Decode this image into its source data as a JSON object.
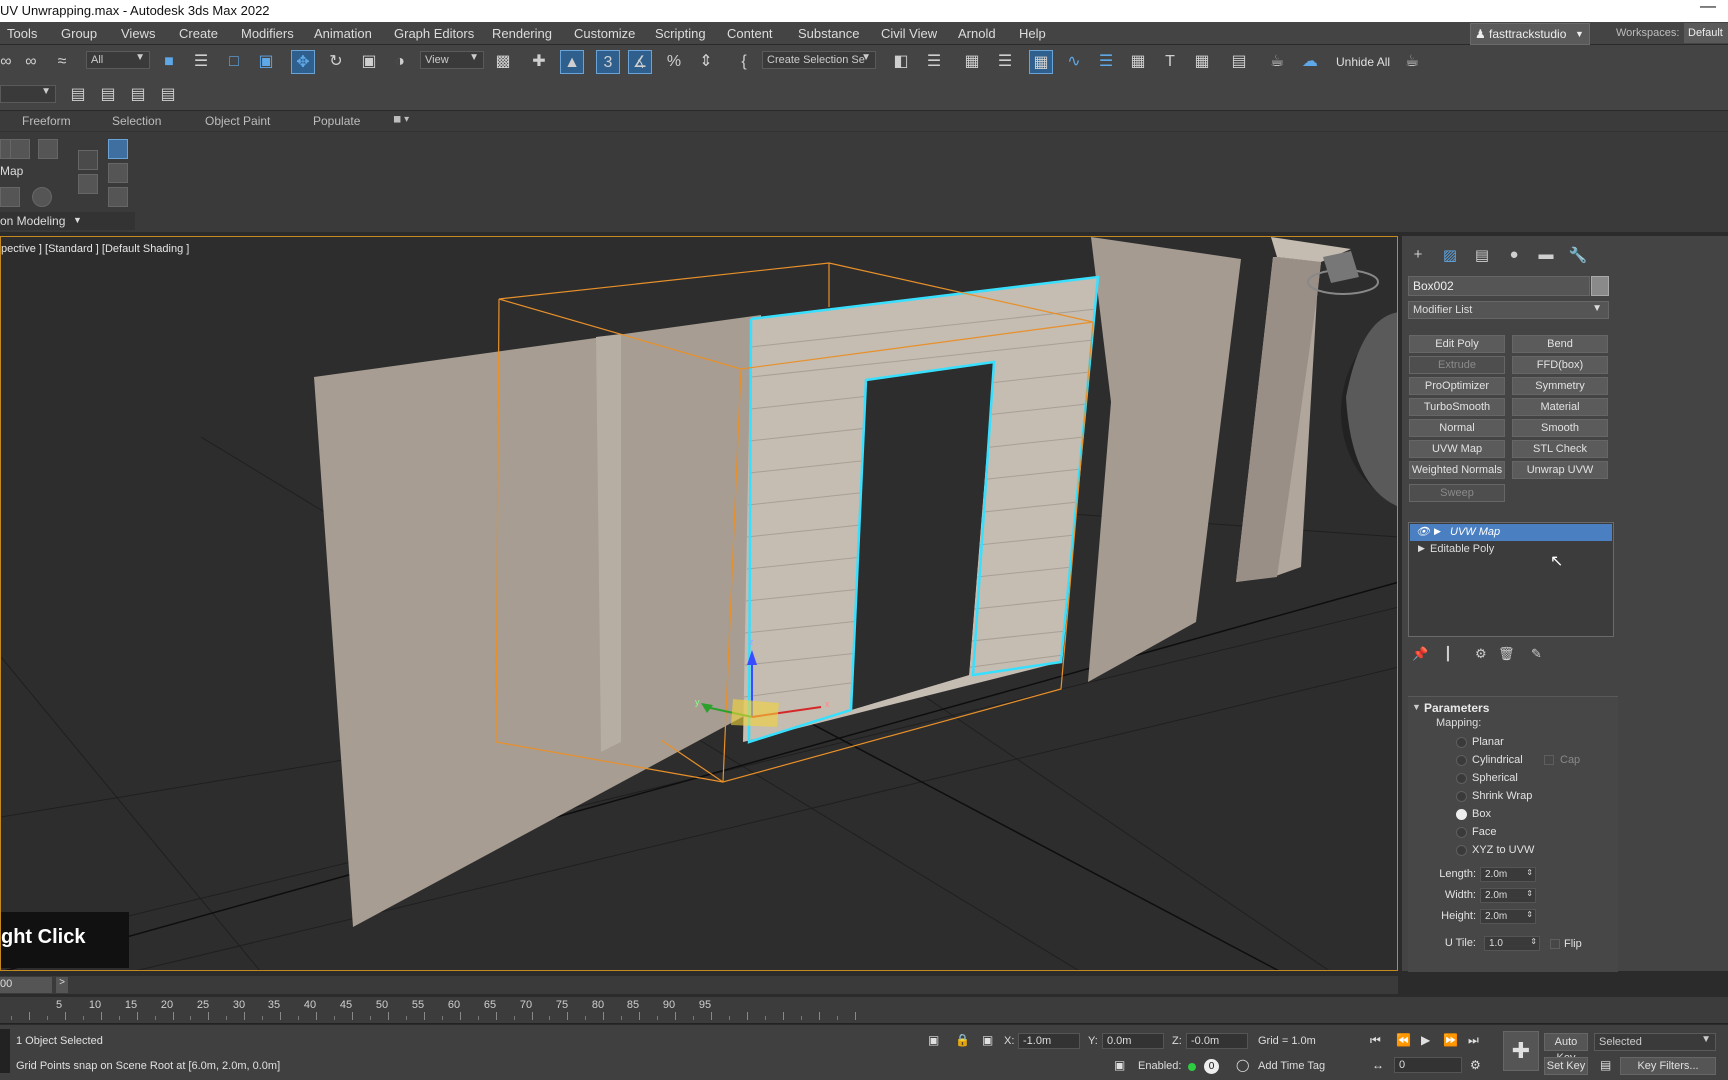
{
  "window": {
    "title": "UV Unwrapping.max - Autodesk 3ds Max 2022",
    "minimize": "—"
  },
  "menu": {
    "items": [
      "Tools",
      "Group",
      "Views",
      "Create",
      "Modifiers",
      "Animation",
      "Graph Editors",
      "Rendering",
      "Customize",
      "Scripting",
      "Content",
      "Substance",
      "Civil View",
      "Arnold",
      "Help"
    ],
    "user": "fasttrackstudio",
    "workspaces_label": "Workspaces:",
    "workspace_value": "Default"
  },
  "toolbar": {
    "filter_value": "All",
    "refcoord_value": "View",
    "named_selection_value": "Create Selection Se",
    "unhide_label": "Unhide All"
  },
  "ribbon": {
    "tabs": [
      "Freeform",
      "Selection",
      "Object Paint",
      "Populate"
    ],
    "map_label": "Map",
    "poly_modeling_label": "on Modeling"
  },
  "viewport": {
    "label": "pective ] [Standard ] [Default Shading ]",
    "hint": "ght Click"
  },
  "command_panel": {
    "object_name": "Box002",
    "object_color": "#8a8a8a",
    "modifier_list": "Modifier List",
    "modifier_buttons": [
      {
        "label": "Edit Poly",
        "enabled": true
      },
      {
        "label": "Bend",
        "enabled": true
      },
      {
        "label": "Extrude",
        "enabled": false
      },
      {
        "label": "FFD(box)",
        "enabled": true
      },
      {
        "label": "ProOptimizer",
        "enabled": true
      },
      {
        "label": "Symmetry",
        "enabled": true
      },
      {
        "label": "TurboSmooth",
        "enabled": true
      },
      {
        "label": "Material",
        "enabled": true
      },
      {
        "label": "Normal",
        "enabled": true
      },
      {
        "label": "Smooth",
        "enabled": true
      },
      {
        "label": "UVW Map",
        "enabled": true
      },
      {
        "label": "STL Check",
        "enabled": true
      },
      {
        "label": "Weighted Normals",
        "enabled": true
      },
      {
        "label": "Unwrap UVW",
        "enabled": true
      },
      {
        "label": "Sweep",
        "enabled": false
      }
    ],
    "stack": [
      {
        "label": "UVW Map",
        "selected": true
      },
      {
        "label": "Editable Poly",
        "selected": false
      }
    ],
    "parameters": {
      "title": "Parameters",
      "mapping_label": "Mapping:",
      "mapping_options": [
        "Planar",
        "Cylindrical",
        "Spherical",
        "Shrink Wrap",
        "Box",
        "Face",
        "XYZ to UVW"
      ],
      "mapping_selected": "Box",
      "cap_label": "Cap",
      "length_label": "Length:",
      "length": "2.0m",
      "width_label": "Width:",
      "width": "2.0m",
      "height_label": "Height:",
      "height": "2.0m",
      "utile_label": "U Tile:",
      "utile": "1.0",
      "flip_label": "Flip"
    }
  },
  "timeline": {
    "slider_value": "00",
    "ruler_ticks": [
      "5",
      "10",
      "15",
      "20",
      "25",
      "30",
      "35",
      "40",
      "45",
      "50",
      "55",
      "60",
      "65",
      "70",
      "75",
      "80",
      "85",
      "90",
      "95"
    ]
  },
  "status": {
    "selection": "1 Object Selected",
    "prompt": "Grid Points snap on Scene Root at [6.0m, 2.0m, 0.0m]",
    "x_label": "X:",
    "x": "-1.0m",
    "y_label": "Y:",
    "y": "0.0m",
    "z_label": "Z:",
    "z": "-0.0m",
    "grid": "Grid = 1.0m",
    "enabled_label": "Enabled:",
    "enabled_count": "0",
    "add_time_tag": "Add Time Tag",
    "auto_key": "Auto Key",
    "set_key": "Set Key",
    "selected_value": "Selected",
    "key_filters": "Key Filters...",
    "frame_value": "0"
  }
}
